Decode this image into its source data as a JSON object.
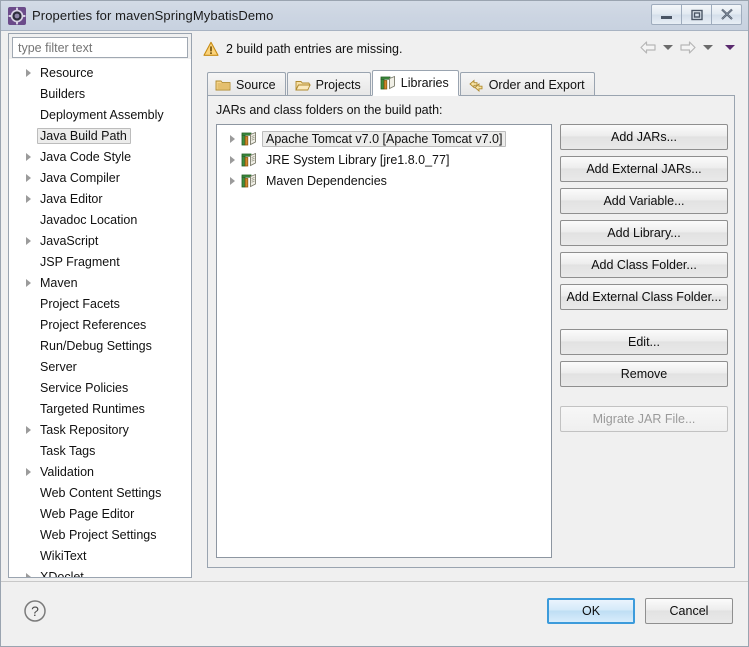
{
  "window": {
    "title": "Properties for mavenSpringMybatisDemo",
    "icon": "eclipse-properties-icon",
    "controls": [
      {
        "name": "minimize-button",
        "glyph": "minimize-icon"
      },
      {
        "name": "maximize-button",
        "glyph": "maximize-icon"
      },
      {
        "name": "close-button",
        "glyph": "close-icon"
      }
    ]
  },
  "sidebar": {
    "filter": {
      "placeholder": "type filter text",
      "value": ""
    },
    "selected": "Java Build Path",
    "items": [
      {
        "label": "Resource",
        "expandable": true
      },
      {
        "label": "Builders",
        "expandable": false
      },
      {
        "label": "Deployment Assembly",
        "expandable": false
      },
      {
        "label": "Java Build Path",
        "expandable": false
      },
      {
        "label": "Java Code Style",
        "expandable": true
      },
      {
        "label": "Java Compiler",
        "expandable": true
      },
      {
        "label": "Java Editor",
        "expandable": true
      },
      {
        "label": "Javadoc Location",
        "expandable": false
      },
      {
        "label": "JavaScript",
        "expandable": true
      },
      {
        "label": "JSP Fragment",
        "expandable": false
      },
      {
        "label": "Maven",
        "expandable": true
      },
      {
        "label": "Project Facets",
        "expandable": false
      },
      {
        "label": "Project References",
        "expandable": false
      },
      {
        "label": "Run/Debug Settings",
        "expandable": false
      },
      {
        "label": "Server",
        "expandable": false
      },
      {
        "label": "Service Policies",
        "expandable": false
      },
      {
        "label": "Targeted Runtimes",
        "expandable": false
      },
      {
        "label": "Task Repository",
        "expandable": true
      },
      {
        "label": "Task Tags",
        "expandable": false
      },
      {
        "label": "Validation",
        "expandable": true
      },
      {
        "label": "Web Content Settings",
        "expandable": false
      },
      {
        "label": "Web Page Editor",
        "expandable": false
      },
      {
        "label": "Web Project Settings",
        "expandable": false
      },
      {
        "label": "WikiText",
        "expandable": false
      },
      {
        "label": "XDoclet",
        "expandable": true
      }
    ]
  },
  "header": {
    "warning_icon": "warning-triangle-icon",
    "message": "2 build path entries are missing.",
    "nav": {
      "back_icon": "back-arrow-icon",
      "back_menu_icon": "chevron-down-icon",
      "forward_icon": "forward-arrow-icon",
      "forward_menu_icon": "chevron-down-icon",
      "menu_icon": "chevron-down-icon"
    }
  },
  "tabs": [
    {
      "label": "Source",
      "icon": "source-folder-icon",
      "active": false
    },
    {
      "label": "Projects",
      "icon": "projects-folder-icon",
      "active": false
    },
    {
      "label": "Libraries",
      "icon": "libraries-books-icon",
      "active": true
    },
    {
      "label": "Order and Export",
      "icon": "order-export-icon",
      "active": false
    }
  ],
  "panel": {
    "list_label": "JARs and class folders on the build path:",
    "entries": [
      {
        "label": "Apache Tomcat v7.0 [Apache Tomcat v7.0]",
        "icon": "library-books-icon",
        "expandable": true,
        "selected": true
      },
      {
        "label": "JRE System Library [jre1.8.0_77]",
        "icon": "library-books-icon",
        "expandable": true,
        "selected": false
      },
      {
        "label": "Maven Dependencies",
        "icon": "library-books-icon",
        "expandable": true,
        "selected": false
      }
    ],
    "buttons": [
      {
        "label": "Add JARs...",
        "name": "add-jars-button",
        "disabled": false,
        "gap": ""
      },
      {
        "label": "Add External JARs...",
        "name": "add-external-jars-button",
        "disabled": false,
        "gap": ""
      },
      {
        "label": "Add Variable...",
        "name": "add-variable-button",
        "disabled": false,
        "gap": ""
      },
      {
        "label": "Add Library...",
        "name": "add-library-button",
        "disabled": false,
        "gap": ""
      },
      {
        "label": "Add Class Folder...",
        "name": "add-class-folder-button",
        "disabled": false,
        "gap": ""
      },
      {
        "label": "Add External Class Folder...",
        "name": "add-external-class-folder-button",
        "disabled": false,
        "gap": ""
      },
      {
        "label": "Edit...",
        "name": "edit-button",
        "disabled": false,
        "gap": "gap-lg"
      },
      {
        "label": "Remove",
        "name": "remove-button",
        "disabled": false,
        "gap": ""
      },
      {
        "label": "Migrate JAR File...",
        "name": "migrate-jar-file-button",
        "disabled": true,
        "gap": "gap-md"
      }
    ]
  },
  "footer": {
    "help_icon": "help-question-icon",
    "ok_label": "OK",
    "cancel_label": "Cancel"
  },
  "colors": {
    "titlebar": "#ccd5e2",
    "accent_default_button": "#3c9bdb",
    "warning": "#f0ad2e",
    "selection": "#ececeb"
  }
}
